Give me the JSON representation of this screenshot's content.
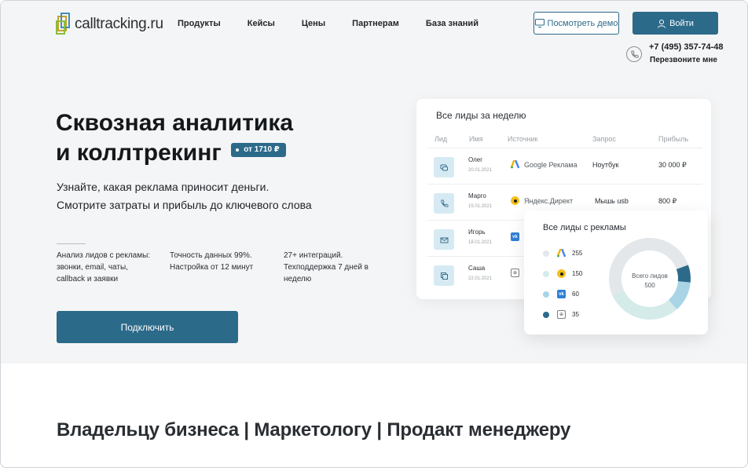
{
  "header": {
    "logo_text": "calltracking.ru",
    "nav": [
      "Продукты",
      "Кейсы",
      "Цены",
      "Партнерам",
      "База знаний"
    ],
    "demo_button": "Посмотреть демо",
    "login_button": "Войти",
    "phone": "+7 (495) 357-74-48",
    "callback": "Перезвоните мне"
  },
  "hero": {
    "title_line1": "Сквозная аналитика",
    "title_line2": "и коллтрекинг",
    "price_badge": "от 1710 ₽",
    "subtitle_line1": "Узнайте, какая реклама приносит деньги.",
    "subtitle_line2": "Смотрите затраты и прибыль до ключевого слова",
    "features": [
      [
        "Анализ лидов с рекламы:",
        "звонки, email, чаты,",
        "callback и заявки"
      ],
      [
        "Точность данных 99%.",
        "Настройка от 12 минут"
      ],
      [
        "27+ интеграций.",
        "Техподдержка 7 дней в",
        "неделю"
      ]
    ],
    "connect_button": "Подключить"
  },
  "leads_card": {
    "title": "Все лиды за неделю",
    "columns": [
      "Лид",
      "Имя",
      "Источник",
      "Запрос",
      "Прибыль"
    ],
    "rows": [
      {
        "name": "Олег",
        "date": "20.01.2021",
        "source": "Google Реклама",
        "source_icon": "google-ads-icon",
        "query": "Ноутбук",
        "profit": "30 000 ₽",
        "lead_icon": "chat-icon"
      },
      {
        "name": "Марго",
        "date": "15.01.2021",
        "source": "Яндекс.Директ",
        "source_icon": "yandex-direct-icon",
        "query": "Мышь usb",
        "profit": "800 ₽",
        "lead_icon": "phone-icon"
      },
      {
        "name": "Игорь",
        "date": "18.01.2021",
        "source": "",
        "source_icon": "vk-icon",
        "query": "",
        "profit": "",
        "lead_icon": "email-icon"
      },
      {
        "name": "Саша",
        "date": "22.01.2021",
        "source": "",
        "source_icon": "mytarget-icon",
        "query": "",
        "profit": "",
        "lead_icon": "form-icon"
      }
    ]
  },
  "ads_card": {
    "title": "Все лиды с рекламы",
    "legend": [
      {
        "icon": "google-ads-icon",
        "value": "255",
        "color": "#e4e7ea"
      },
      {
        "icon": "yandex-direct-icon",
        "value": "150",
        "color": "#d4ebe9"
      },
      {
        "icon": "vk-icon",
        "value": "60",
        "color": "#a9d4e6"
      },
      {
        "icon": "mytarget-icon",
        "value": "35",
        "color": "#2c6a8a"
      }
    ],
    "donut_label": "Всего лидов",
    "donut_value": "500"
  },
  "section": {
    "heading": "Владельцу бизнеса | Маркетологу | Продакт менеджеру"
  },
  "colors": {
    "accent": "#2c6a8a",
    "hero_bg": "#f4f5f6"
  }
}
